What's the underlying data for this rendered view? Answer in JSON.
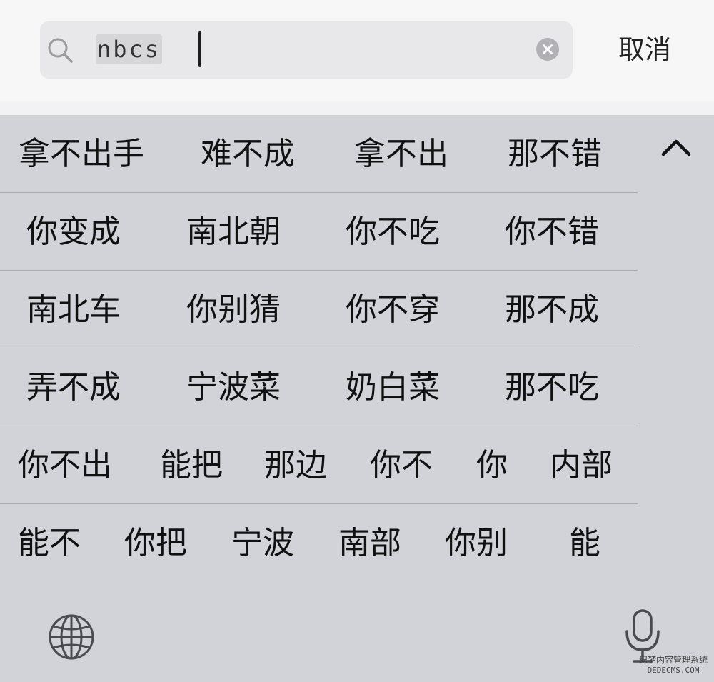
{
  "search": {
    "query": "nbcs",
    "cancel_label": "取消"
  },
  "candidates": {
    "rows": [
      [
        "拿不出手",
        "难不成",
        "拿不出",
        "那不错"
      ],
      [
        "你变成",
        "南北朝",
        "你不吃",
        "你不错"
      ],
      [
        "南北车",
        "你别猜",
        "你不穿",
        "那不成"
      ],
      [
        "弄不成",
        "宁波菜",
        "奶白菜",
        "那不吃"
      ],
      [
        "你不出",
        "能把",
        "那边",
        "你不",
        "你",
        "内部"
      ],
      [
        "能不",
        "你把",
        "宁波",
        "南部",
        "你别",
        "能"
      ]
    ]
  },
  "icons": {
    "search": "search-icon",
    "clear": "clear-icon",
    "collapse": "chevron-up-icon",
    "globe": "globe-icon",
    "microphone": "microphone-icon"
  },
  "watermark": {
    "line1": "织梦内容管理系统",
    "line2": "DEDECMS.COM"
  },
  "colors": {
    "keyboard_background": "#d1d3d9",
    "search_background": "#f7f7f7",
    "field_background": "#e8e8ea",
    "text": "#111111"
  }
}
